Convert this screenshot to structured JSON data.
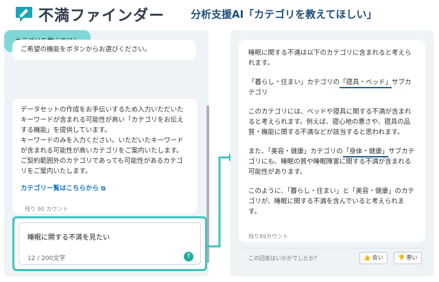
{
  "header": {
    "brand": "不満ファインダー",
    "title": "分析支援AI「カテゴリを教えてほしい」"
  },
  "chat": {
    "prompt_message": "ご希望の機能をボタンからお選びください。",
    "user_message": "カテゴリを教えてほしい",
    "answer_lines": [
      "データセットの作成をお手伝いするため入力いただいた",
      "キーワードが含まれる可能性が高い「カテゴリをお伝え",
      "する機能」を提供しています。",
      "キーワードのみを入力ください。いただいたキーワード",
      "が含まれる可能性が高いカテゴリをご案内いたします。",
      "ご契約範囲外のカテゴリであっても可能性があるカテゴ",
      "リをご案内いたします。"
    ],
    "category_link": "カテゴリー覧はこちらから",
    "remaining": "残り 90 カウント"
  },
  "input": {
    "value": "睡眠に関する不満を見たい",
    "char_count": "12 / 200文字"
  },
  "response": {
    "p1": "睡眠に関する不満は以下のカテゴリに含まれると考えられます。",
    "p2_a": "「暮らし・住まい」カテゴリの",
    "p2_b": "「寝具・ベッド」",
    "p2_c": "サブカテゴリ",
    "p3": "このカテゴリには、ベッドや寝具に関する不満が含まれると考えられます。例えば、寝心地の悪さや、寝具の品質・機能に関する不満などが該当すると思われます。",
    "p4_a": "また、「美容・健康」カテゴリの",
    "p4_b": "「身体・健康」",
    "p4_c": "サブカテゴリにも、睡眠の質や睡眠障害に関する不満が含まれる可能性があります。",
    "p5": "このように、「暮らし・住まい」と「美容・健康」のカテゴリが、睡眠に関する不満を含んでいると考えられます。",
    "remaining": "残り89カウント",
    "feedback_question": "この回答はいかがでしたか？",
    "good_label": "良い",
    "bad_label": "悪い"
  },
  "colors": {
    "accent": "#3fc4c0",
    "user_bubble": "#7fd8d6",
    "link": "#1c7bc0",
    "title": "#1f4e79"
  }
}
